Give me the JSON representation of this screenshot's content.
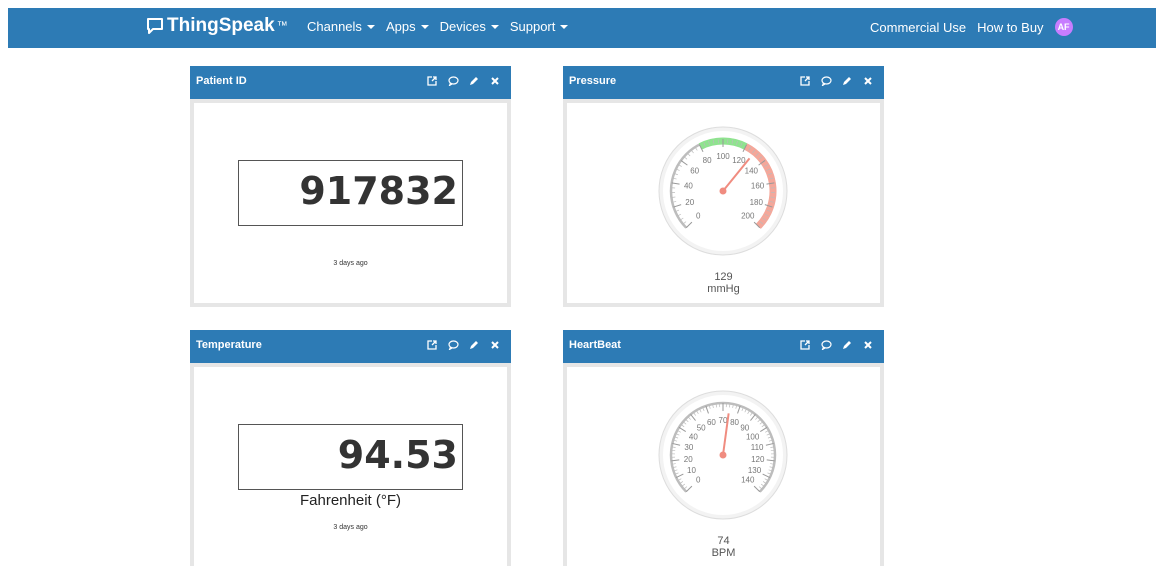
{
  "header": {
    "brand": "ThingSpeak",
    "tm": "™",
    "nav": [
      "Channels",
      "Apps",
      "Devices",
      "Support"
    ],
    "right": [
      "Commercial Use",
      "How to Buy"
    ],
    "avatar": "AF"
  },
  "widgets": {
    "patient": {
      "title": "Patient ID",
      "value": "917832",
      "updated": "3 days ago"
    },
    "pressure": {
      "title": "Pressure",
      "value": "129",
      "unit": "mmHg",
      "min": 0,
      "max": 200,
      "reading": 129,
      "ticks": [
        "0",
        "20",
        "40",
        "60",
        "80",
        "100",
        "120",
        "140",
        "160",
        "180",
        "200"
      ],
      "green_band": [
        80,
        120
      ],
      "red_band": [
        120,
        200
      ]
    },
    "temperature": {
      "title": "Temperature",
      "value": "94.53",
      "unit": "Fahrenheit (°F)",
      "updated": "3 days ago"
    },
    "heartbeat": {
      "title": "HeartBeat",
      "value": "74",
      "unit": "BPM",
      "min": 0,
      "max": 140,
      "reading": 74,
      "ticks": [
        "0",
        "10",
        "20",
        "30",
        "40",
        "50",
        "60",
        "70",
        "80",
        "90",
        "100",
        "110",
        "120",
        "130",
        "140"
      ]
    }
  },
  "colors": {
    "header": "#2d7bb5",
    "gauge_green": "#8fe38f",
    "gauge_red": "#f4a79a",
    "needle": "#f08c80"
  }
}
